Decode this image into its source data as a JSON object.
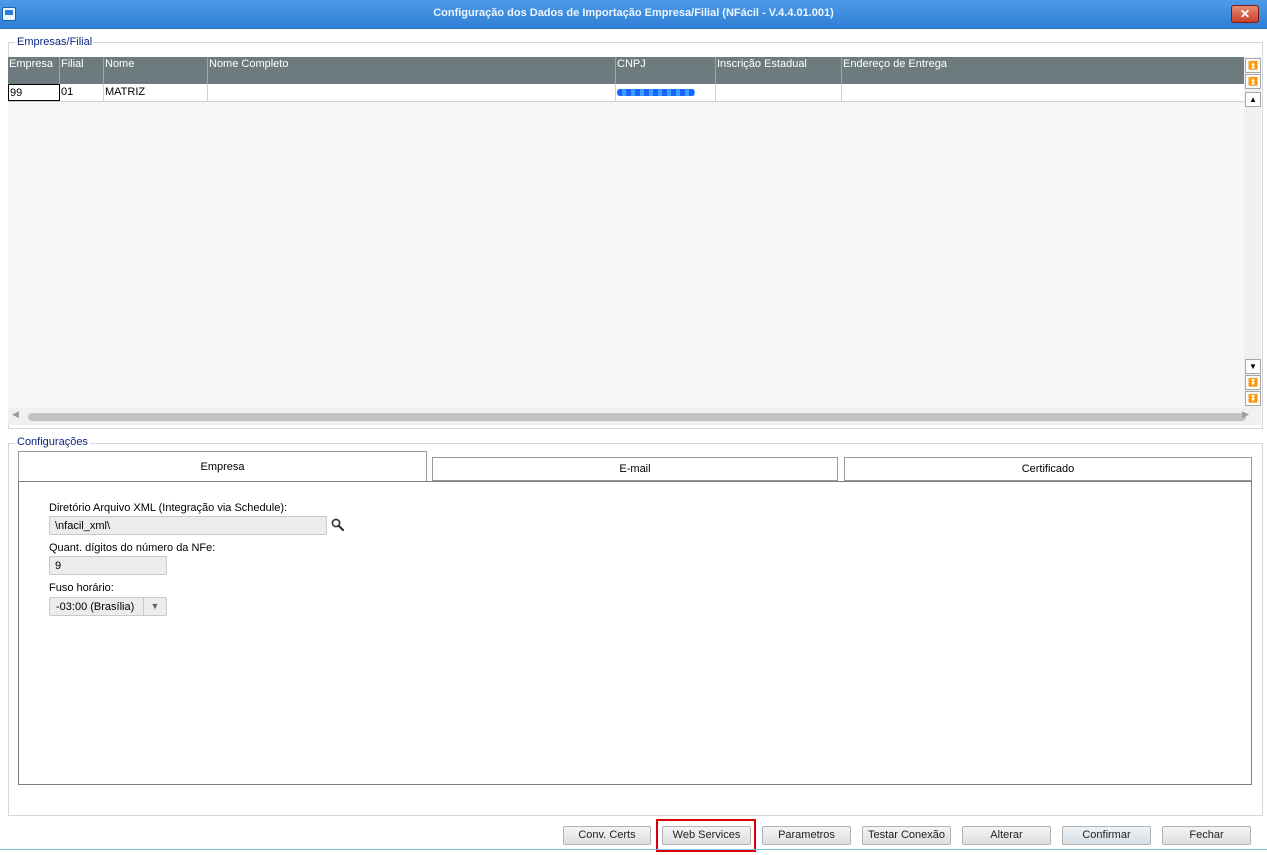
{
  "window": {
    "title": "Configuração dos Dados de Importação Empresa/Filial (NFácil - V.4.4.01.001)",
    "close_label": "✕"
  },
  "companies_group": {
    "title": "Empresas/Filial",
    "columns": [
      "Empresa",
      "Filial",
      "Nome",
      "Nome Completo",
      "CNPJ",
      "Inscrição Estadual",
      "Endereço de Entrega"
    ],
    "rows": [
      {
        "empresa": "99",
        "filial": "01",
        "nome": "MATRIZ",
        "nome_completo": "",
        "cnpj": "",
        "inscricao_estadual": "",
        "endereco_entrega": ""
      }
    ]
  },
  "config_group": {
    "title": "Configurações",
    "tabs": [
      "Empresa",
      "E-mail",
      "Certificado"
    ],
    "active_tab": "Empresa",
    "fields": {
      "xml_dir_label": "Diretório Arquivo XML (Integração via Schedule):",
      "xml_dir_value": "\\nfacil_xml\\",
      "digits_label": "Quant. dígitos do número da NFe:",
      "digits_value": "9",
      "timezone_label": "Fuso horário:",
      "timezone_value": "-03:00 (Brasília)"
    }
  },
  "buttons": {
    "conv_certs": "Conv. Certs",
    "web_services": "Web Services",
    "parametros": "Parametros",
    "testar_conexao": "Testar Conexão",
    "alterar": "Alterar",
    "confirmar": "Confirmar",
    "fechar": "Fechar"
  },
  "colors": {
    "title_bar": "#3a8ae0",
    "grid_header": "#6d7b7e",
    "group_title": "#0c2680",
    "highlight": "#d8000a"
  }
}
